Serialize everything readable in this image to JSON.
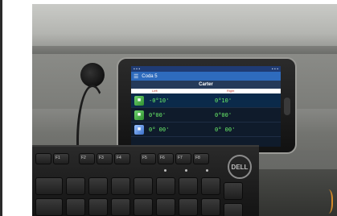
{
  "phone": {
    "app_title": "Carter",
    "app_bar_left": "Coda 5",
    "columns": [
      "Left",
      "Right"
    ],
    "rows": [
      {
        "icon": "green-square-icon",
        "left": "-0°10'",
        "right": "0°10'"
      },
      {
        "icon": "green-square-icon",
        "left": "0°00'",
        "right": "0°00'"
      },
      {
        "icon": "blue-square-icon",
        "left": "0° 00'",
        "right": "0° 00'"
      }
    ]
  },
  "keyboard": {
    "brand": "DELL",
    "keys": [
      "F1",
      "F2",
      "F3",
      "F4",
      "F5",
      "F6",
      "F7",
      "F8"
    ]
  }
}
